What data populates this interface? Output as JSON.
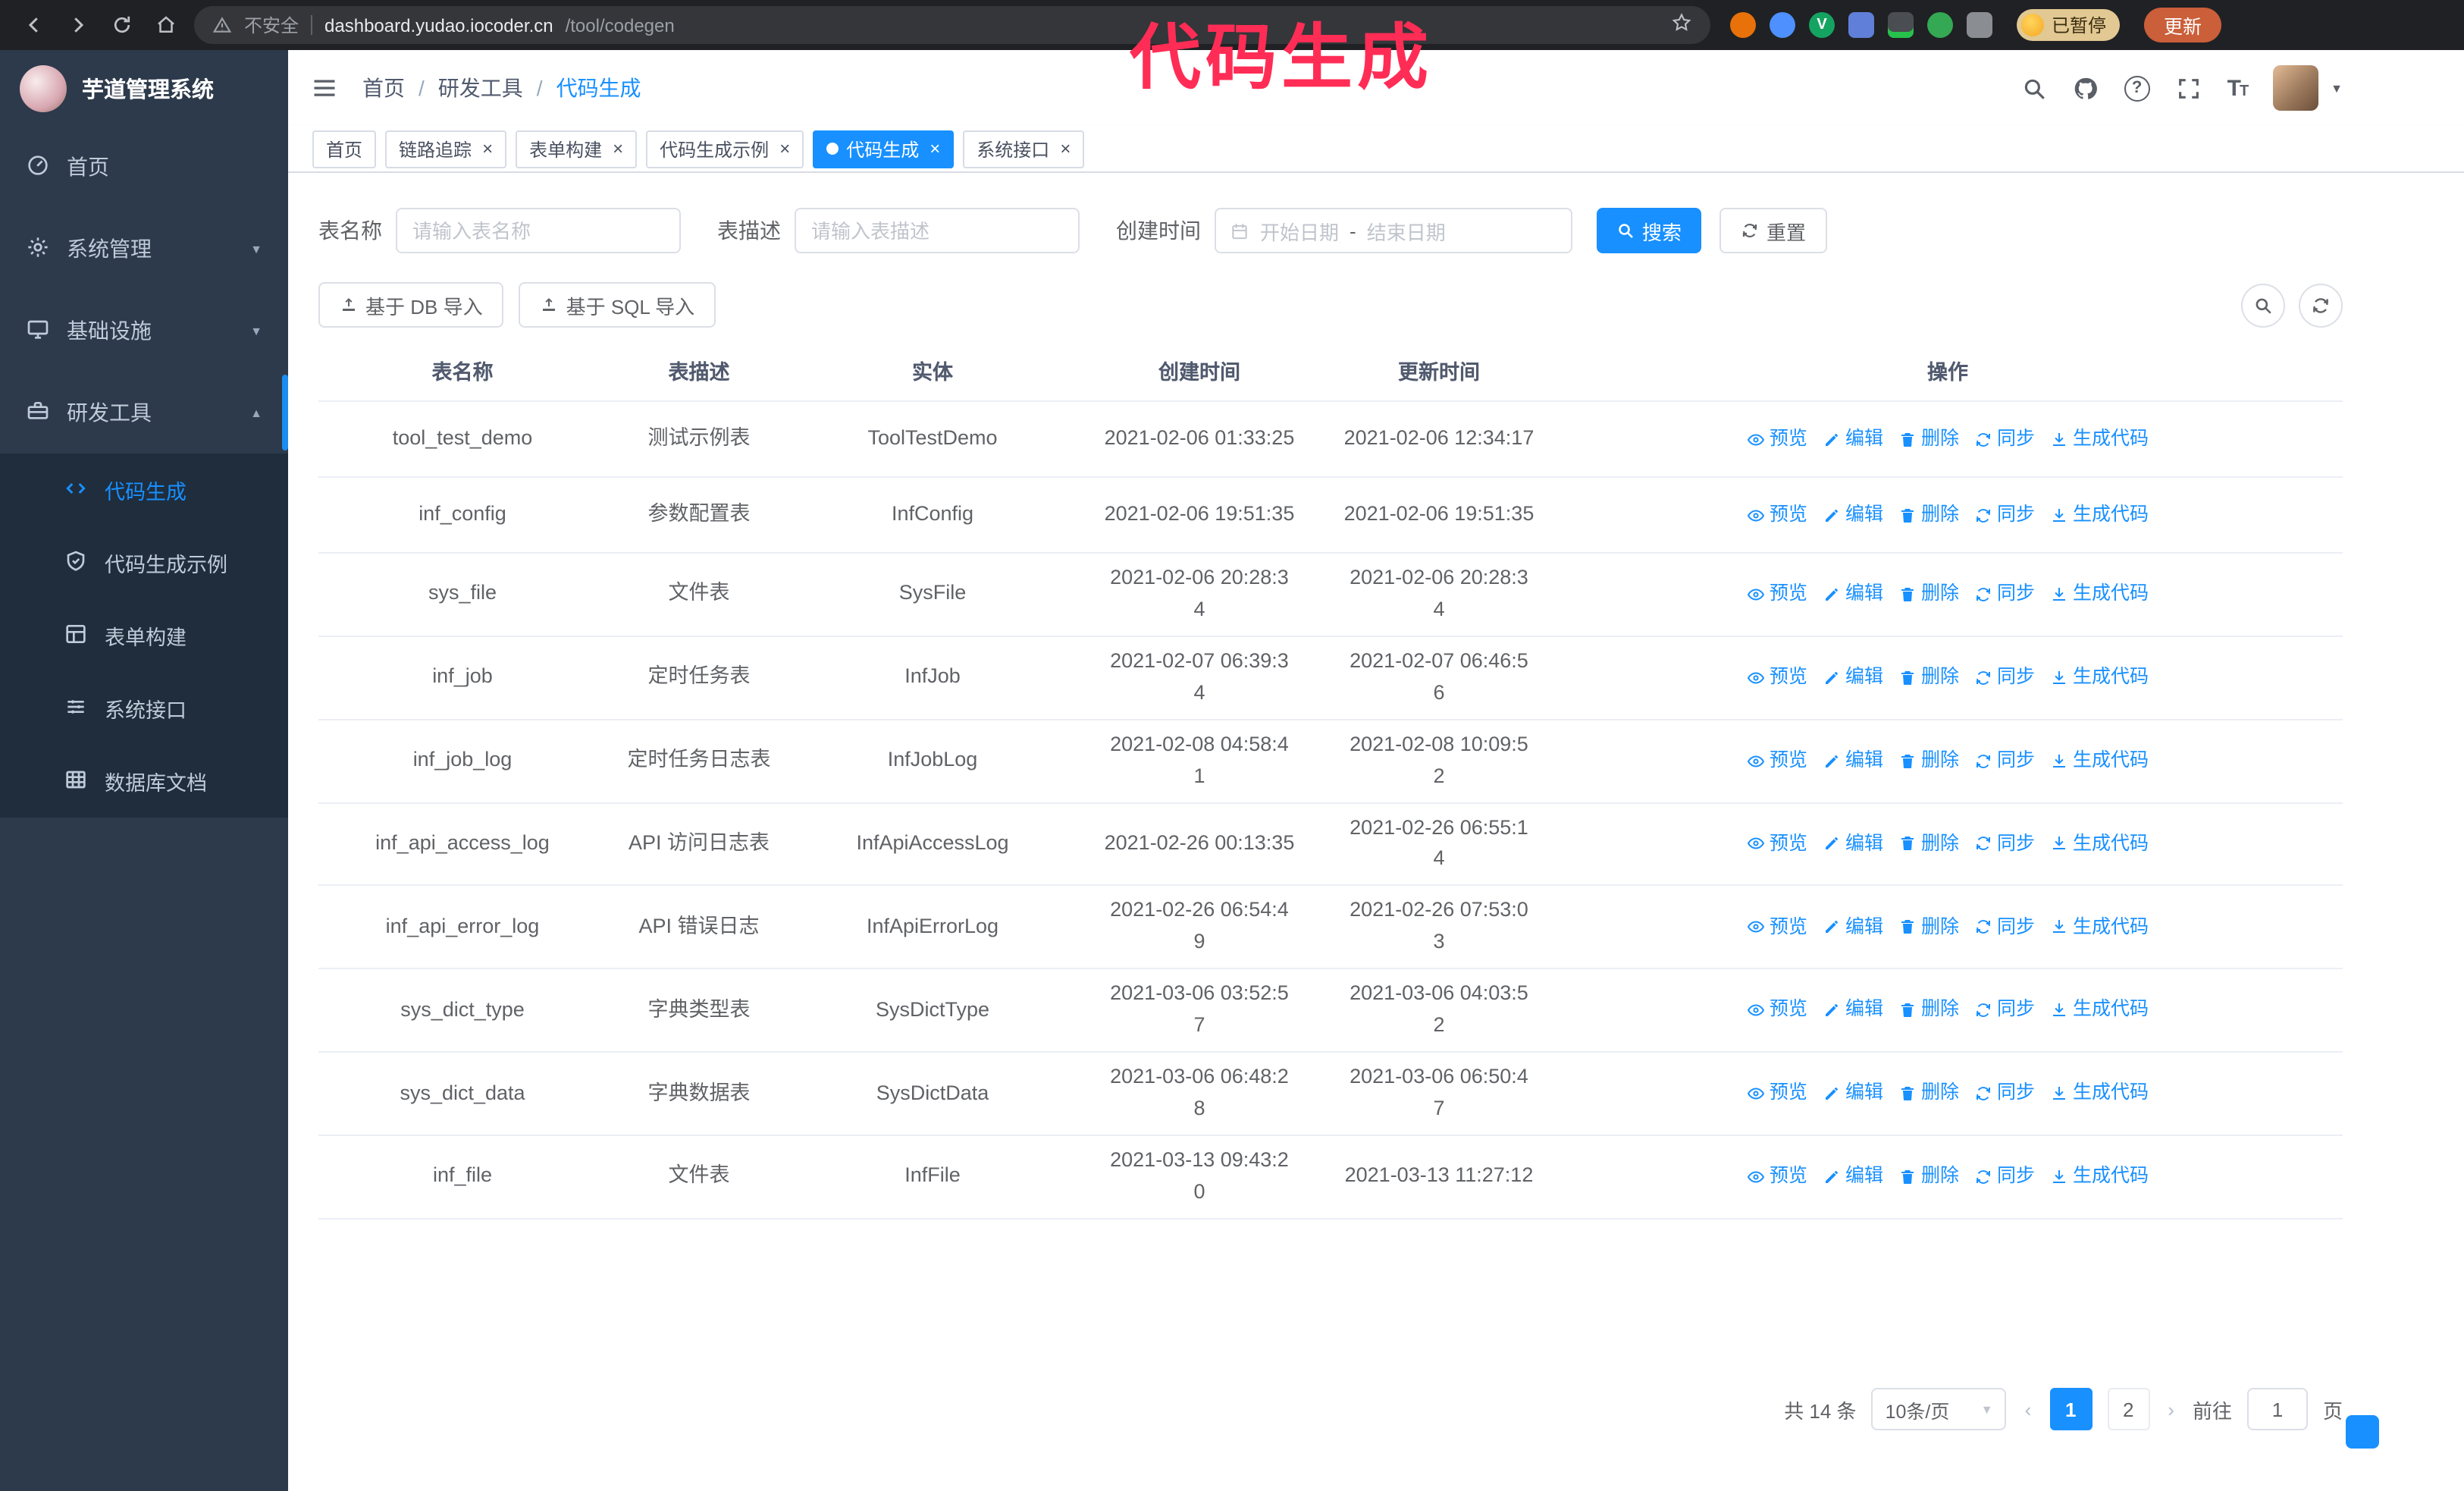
{
  "colors": {
    "primary": "#1890ff",
    "sidebar_bg": "#2d3a4b",
    "submenu_bg": "#1f2d3d"
  },
  "annotation": {
    "text": "代码生成",
    "color": "#ff2d55"
  },
  "chrome": {
    "security_label": "不安全",
    "url_host": "dashboard.yudao.iocoder.cn",
    "url_path": "/tool/codegen",
    "paused_badge": "已暂停",
    "update_button": "更新"
  },
  "sidebar": {
    "logo_title": "芋道管理系统",
    "items": [
      {
        "label": "首页"
      },
      {
        "label": "系统管理"
      },
      {
        "label": "基础设施"
      },
      {
        "label": "研发工具"
      }
    ],
    "sub_items": [
      {
        "label": "代码生成"
      },
      {
        "label": "代码生成示例"
      },
      {
        "label": "表单构建"
      },
      {
        "label": "系统接口"
      },
      {
        "label": "数据库文档"
      }
    ]
  },
  "header": {
    "breadcrumb": [
      "首页",
      "研发工具",
      "代码生成"
    ]
  },
  "tabs": [
    {
      "label": "首页",
      "closable": false,
      "active": false
    },
    {
      "label": "链路追踪",
      "closable": true,
      "active": false
    },
    {
      "label": "表单构建",
      "closable": true,
      "active": false
    },
    {
      "label": "代码生成示例",
      "closable": true,
      "active": false
    },
    {
      "label": "代码生成",
      "closable": true,
      "active": true
    },
    {
      "label": "系统接口",
      "closable": true,
      "active": false
    }
  ],
  "filters": {
    "name_label": "表名称",
    "name_placeholder": "请输入表名称",
    "desc_label": "表描述",
    "desc_placeholder": "请输入表描述",
    "time_label": "创建时间",
    "start_placeholder": "开始日期",
    "range_separator": "-",
    "end_placeholder": "结束日期",
    "search_button": "搜索",
    "reset_button": "重置"
  },
  "toolbar": {
    "import_db": "基于 DB 导入",
    "import_sql": "基于 SQL 导入"
  },
  "table": {
    "columns": [
      "表名称",
      "表描述",
      "实体",
      "创建时间",
      "更新时间",
      "操作"
    ],
    "actions": [
      "预览",
      "编辑",
      "删除",
      "同步",
      "生成代码"
    ],
    "rows": [
      {
        "name": "tool_test_demo",
        "description": "测试示例表",
        "entity": "ToolTestDemo",
        "created": "2021-02-06 01:33:25",
        "updated": "2021-02-06 12:34:17"
      },
      {
        "name": "inf_config",
        "description": "参数配置表",
        "entity": "InfConfig",
        "created": "2021-02-06 19:51:35",
        "updated": "2021-02-06 19:51:35"
      },
      {
        "name": "sys_file",
        "description": "文件表",
        "entity": "SysFile",
        "created": "2021-02-06 20:28:3\n4",
        "updated": "2021-02-06 20:28:3\n4"
      },
      {
        "name": "inf_job",
        "description": "定时任务表",
        "entity": "InfJob",
        "created": "2021-02-07 06:39:3\n4",
        "updated": "2021-02-07 06:46:5\n6"
      },
      {
        "name": "inf_job_log",
        "description": "定时任务日志表",
        "entity": "InfJobLog",
        "created": "2021-02-08 04:58:4\n1",
        "updated": "2021-02-08 10:09:5\n2"
      },
      {
        "name": "inf_api_access_log",
        "description": "API 访问日志表",
        "entity": "InfApiAccessLog",
        "created": "2021-02-26 00:13:35",
        "updated": "2021-02-26 06:55:1\n4"
      },
      {
        "name": "inf_api_error_log",
        "description": "API 错误日志",
        "entity": "InfApiErrorLog",
        "created": "2021-02-26 06:54:4\n9",
        "updated": "2021-02-26 07:53:0\n3"
      },
      {
        "name": "sys_dict_type",
        "description": "字典类型表",
        "entity": "SysDictType",
        "created": "2021-03-06 03:52:5\n7",
        "updated": "2021-03-06 04:03:5\n2"
      },
      {
        "name": "sys_dict_data",
        "description": "字典数据表",
        "entity": "SysDictData",
        "created": "2021-03-06 06:48:2\n8",
        "updated": "2021-03-06 06:50:4\n7"
      },
      {
        "name": "inf_file",
        "description": "文件表",
        "entity": "InfFile",
        "created": "2021-03-13 09:43:2\n0",
        "updated": "2021-03-13 11:27:12"
      }
    ]
  },
  "pagination": {
    "total": "共 14 条",
    "page_size": "10条/页",
    "pages": [
      "1",
      "2"
    ],
    "active_page": "1",
    "goto_label": "前往",
    "goto_value": "1",
    "goto_suffix": "页"
  }
}
